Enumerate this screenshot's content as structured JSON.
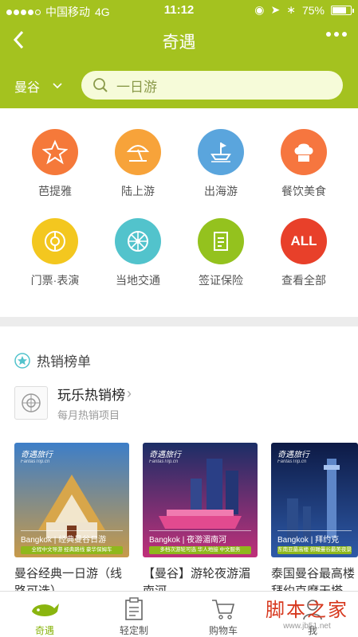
{
  "status": {
    "carrier": "中国移动",
    "network": "4G",
    "time": "11:12",
    "battery": "75%",
    "battery_level": 0.75
  },
  "nav": {
    "title": "奇遇"
  },
  "search": {
    "city": "曼谷",
    "placeholder": "一日游"
  },
  "categories": [
    {
      "label": "芭提雅",
      "icon": "star-icon",
      "color": "#f5793a"
    },
    {
      "label": "陆上游",
      "icon": "umbrella-icon",
      "color": "#f7a33a"
    },
    {
      "label": "出海游",
      "icon": "boat-icon",
      "color": "#5aa5dd"
    },
    {
      "label": "餐饮美食",
      "icon": "chef-hat-icon",
      "color": "#f6763f"
    },
    {
      "label": "门票·表演",
      "icon": "ticket-icon",
      "color": "#f3c71f"
    },
    {
      "label": "当地交通",
      "icon": "wheel-icon",
      "color": "#52c3cc"
    },
    {
      "label": "签证保险",
      "icon": "document-icon",
      "color": "#94c21e"
    },
    {
      "label": "查看全部",
      "icon": "all-icon",
      "icon_text": "ALL",
      "color": "#e8402a"
    }
  ],
  "hot": {
    "title": "热销榜单",
    "rank_title": "玩乐热销榜",
    "rank_sub": "每月热销项目",
    "cards": [
      {
        "logo": "奇遇旅行",
        "logo_sub": "FantasTrip.cn",
        "caption": "Bangkok | 经典曼谷日游",
        "tag": "全程中文导游 经典路线 豪华保姆车",
        "desc": "曼谷经典一日游（线路可选）",
        "colors": [
          "#3d7ec8",
          "#c79a4a"
        ]
      },
      {
        "logo": "奇遇旅行",
        "logo_sub": "FantasTrip.cn",
        "caption": "Bangkok | 夜游湄南河",
        "tag": "多档次游轮可选 华人地接 中文服务",
        "desc": "【曼谷】游轮夜游湄南河",
        "colors": [
          "#1b2e66",
          "#c0307a"
        ]
      },
      {
        "logo": "奇遇旅行",
        "logo_sub": "FantasTrip.cn",
        "caption": "Bangkok | 拜约克",
        "tag": "东南亚最高楼 俯瞰曼谷最美夜景",
        "desc": "泰国曼谷最高楼拜约克摩天塔Baiyo",
        "colors": [
          "#0d1a45",
          "#2e5aa8"
        ]
      }
    ]
  },
  "tabs": [
    {
      "label": "奇遇",
      "icon": "whale-icon",
      "active": true
    },
    {
      "label": "轻定制",
      "icon": "clipboard-icon",
      "active": false
    },
    {
      "label": "购物车",
      "icon": "cart-icon",
      "active": false
    },
    {
      "label": "我",
      "icon": "user-icon",
      "active": false
    }
  ],
  "watermark": {
    "text": "脚本之家",
    "url": "www.jb51.net"
  }
}
